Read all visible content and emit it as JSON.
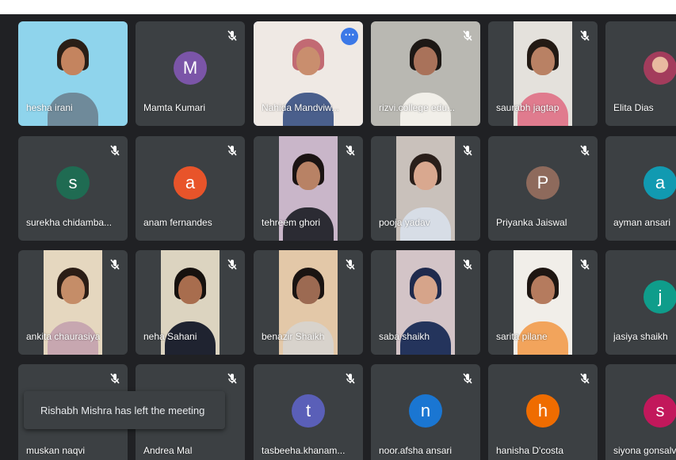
{
  "participants": [
    {
      "name": "hesha irani",
      "mic": "",
      "kind": "video",
      "bg": "#8fd4ec",
      "hair": "#2a1e16",
      "skin": "#c4845f",
      "shirt": "#6f8a9a"
    },
    {
      "name": "Mamta Kumari",
      "mic": "muted",
      "kind": "avatar",
      "initial": "M",
      "color": "#7b55a8"
    },
    {
      "name": "Nahida Mandviw...",
      "mic": "",
      "kind": "video",
      "bg": "#efe9e4",
      "hair": "#c26a73",
      "skin": "#c98e6e",
      "shirt": "#4a5f8c",
      "active": true,
      "more": "⋯"
    },
    {
      "name": "rizvi.college edu...",
      "mic": "muted",
      "kind": "video",
      "bg": "#b9b8b2",
      "hair": "#1d1815",
      "skin": "#a9725a",
      "shirt": "#f1efe9"
    },
    {
      "name": "saurabh jagtap",
      "mic": "muted",
      "kind": "video",
      "bg": "#e4e1dc",
      "hair": "#231a14",
      "skin": "#b98164",
      "shirt": "#e07b8e"
    },
    {
      "name": "Elita Dias",
      "mic": "",
      "kind": "avatar-photo",
      "color": "#a33c5c"
    },
    {
      "name": "surekha chidamba...",
      "mic": "muted",
      "kind": "avatar",
      "initial": "s",
      "color": "#1f6b52"
    },
    {
      "name": "anam fernandes",
      "mic": "muted",
      "kind": "avatar",
      "initial": "a",
      "color": "#e8542a"
    },
    {
      "name": "tehreem ghori",
      "mic": "muted",
      "kind": "video",
      "bg": "#c9b6c9",
      "hair": "#1b1413",
      "skin": "#b88265",
      "shirt": "#2b2b33"
    },
    {
      "name": "pooja yadav",
      "mic": "muted",
      "kind": "video",
      "bg": "#c9c1bb",
      "hair": "#2a1f1a",
      "skin": "#d9a88f",
      "shirt": "#d7dde6"
    },
    {
      "name": "Priyanka Jaiswal",
      "mic": "muted",
      "kind": "avatar",
      "initial": "P",
      "color": "#8e6a5c"
    },
    {
      "name": "ayman ansari",
      "mic": "",
      "kind": "avatar",
      "initial": "a",
      "color": "#119ab1"
    },
    {
      "name": "ankita chaurasiya",
      "mic": "muted",
      "kind": "video",
      "bg": "#e5d7bf",
      "hair": "#2b1d15",
      "skin": "#c58d68",
      "shirt": "#c7a7b0"
    },
    {
      "name": "neha Sahani",
      "mic": "muted",
      "kind": "video",
      "bg": "#dcd4c0",
      "hair": "#16110e",
      "skin": "#a86d4e",
      "shirt": "#1f2330"
    },
    {
      "name": "benazir Shaikh",
      "mic": "muted",
      "kind": "video",
      "bg": "#e3c8a8",
      "hair": "#1a1412",
      "skin": "#9c6a52",
      "shirt": "#d8d3cc"
    },
    {
      "name": "saba shaikh",
      "mic": "muted",
      "kind": "video",
      "bg": "#d3c4c7",
      "hair": "#1f2a4d",
      "skin": "#d6a48a",
      "shirt": "#24345c"
    },
    {
      "name": "sarita pilane",
      "mic": "muted",
      "kind": "video",
      "bg": "#f1eee9",
      "hair": "#1e1612",
      "skin": "#b57b5e",
      "shirt": "#f2a45c"
    },
    {
      "name": "jasiya shaikh",
      "mic": "",
      "kind": "avatar",
      "initial": "j",
      "color": "#0f9d8b"
    },
    {
      "name": "muskan naqvi",
      "mic": "muted",
      "kind": "avatar",
      "initial": "",
      "color": "#b3125a"
    },
    {
      "name": "Andrea Mal",
      "mic": "muted",
      "kind": "avatar-photo",
      "color": "#8a9a8c"
    },
    {
      "name": "tasbeeha.khanam...",
      "mic": "muted",
      "kind": "avatar",
      "initial": "t",
      "color": "#5a5fb8"
    },
    {
      "name": "noor.afsha ansari",
      "mic": "muted",
      "kind": "avatar",
      "initial": "n",
      "color": "#1a76d2"
    },
    {
      "name": "hanisha D'costa",
      "mic": "muted",
      "kind": "avatar",
      "initial": "h",
      "color": "#ef6c00"
    },
    {
      "name": "siyona gonsalv...",
      "mic": "",
      "kind": "avatar",
      "initial": "s",
      "color": "#c2185b"
    }
  ],
  "toast": {
    "message": "Rishabh Mishra has left the meeting"
  },
  "icons": {
    "mic_off": "mic-off-icon",
    "more": "more-options-icon"
  }
}
